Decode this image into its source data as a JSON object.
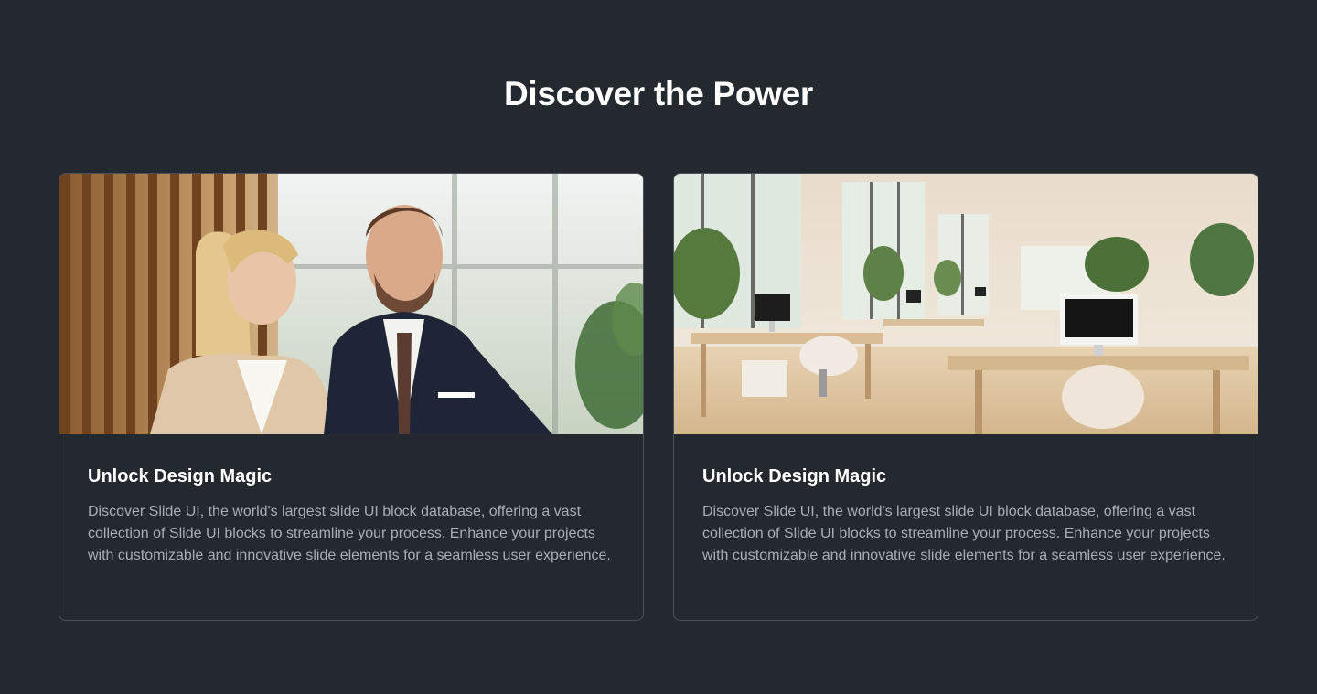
{
  "section": {
    "title": "Discover the Power"
  },
  "cards": [
    {
      "image_alt": "Business people portrait",
      "title": "Unlock Design Magic",
      "text": "Discover Slide UI, the world's largest slide UI block database, offering a vast collection of Slide UI blocks to streamline your process. Enhance your projects with customizable and innovative slide elements for a seamless user experience."
    },
    {
      "image_alt": "Modern office interior",
      "title": "Unlock Design Magic",
      "text": "Discover Slide UI, the world's largest slide UI block database, offering a vast collection of Slide UI blocks to streamline your process. Enhance your projects with customizable and innovative slide elements for a seamless user experience."
    }
  ],
  "colors": {
    "background": "#23292f",
    "card_border": "#4a525a",
    "heading": "#ffffff",
    "body_text": "#a9aeb4"
  }
}
